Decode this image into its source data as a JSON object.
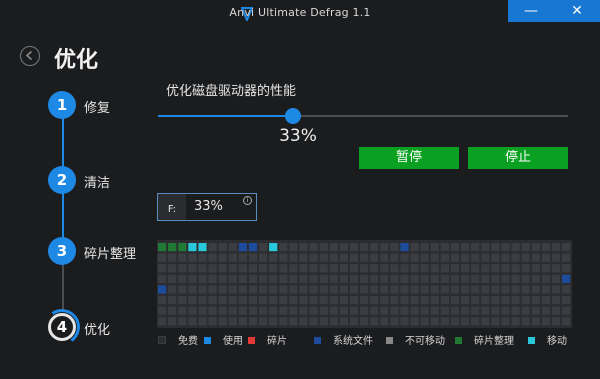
{
  "window": {
    "title": "Anvi Ultimate Defrag 1.1",
    "minimize_glyph": "—",
    "close_glyph": "✕"
  },
  "page": {
    "title": "优化"
  },
  "steps": [
    {
      "number": "1",
      "label": "修复",
      "state": "done"
    },
    {
      "number": "2",
      "label": "清洁",
      "state": "done"
    },
    {
      "number": "3",
      "label": "碎片整理",
      "state": "done"
    },
    {
      "number": "4",
      "label": "优化",
      "state": "active"
    }
  ],
  "optimize": {
    "section_title": "优化磁盘驱动器的性能",
    "progress_value": 33,
    "progress_text": "33%",
    "pause_label": "暂停",
    "stop_label": "停止"
  },
  "drive": {
    "letter": "F:",
    "percent": "33%",
    "info_glyph": "i"
  },
  "disk_map": {
    "columns": 41,
    "rows": 8,
    "highlighted_cells": [
      {
        "row": 0,
        "col": 0,
        "type": "fragmented"
      },
      {
        "row": 0,
        "col": 1,
        "type": "fragmented"
      },
      {
        "row": 0,
        "col": 2,
        "type": "fragmented"
      },
      {
        "row": 0,
        "col": 3,
        "type": "moving"
      },
      {
        "row": 0,
        "col": 4,
        "type": "moving"
      },
      {
        "row": 0,
        "col": 8,
        "type": "system"
      },
      {
        "row": 0,
        "col": 9,
        "type": "system"
      },
      {
        "row": 0,
        "col": 11,
        "type": "moving"
      },
      {
        "row": 0,
        "col": 24,
        "type": "system"
      },
      {
        "row": 3,
        "col": 40,
        "type": "system"
      },
      {
        "row": 4,
        "col": 0,
        "type": "system"
      }
    ]
  },
  "legend": [
    {
      "label": "免费",
      "color": "#2b2d31",
      "type": "free"
    },
    {
      "label": "使用",
      "color": "#1e88e5",
      "type": "used"
    },
    {
      "label": "碎片",
      "color": "#e53935",
      "type": "fragment"
    },
    {
      "label": "系统文件",
      "color": "#1d4c9c",
      "type": "system"
    },
    {
      "label": "不可移动",
      "color": "#8a8a8a",
      "type": "unmovable"
    },
    {
      "label": "碎片整理",
      "color": "#1f7a33",
      "type": "fragmented"
    },
    {
      "label": "移动",
      "color": "#29c9d9",
      "type": "moving"
    }
  ],
  "colors": {
    "accent": "#1e88e5",
    "button_green": "#0aa021",
    "background": "#1b1c1e",
    "cell_default": "#3b3d42"
  }
}
